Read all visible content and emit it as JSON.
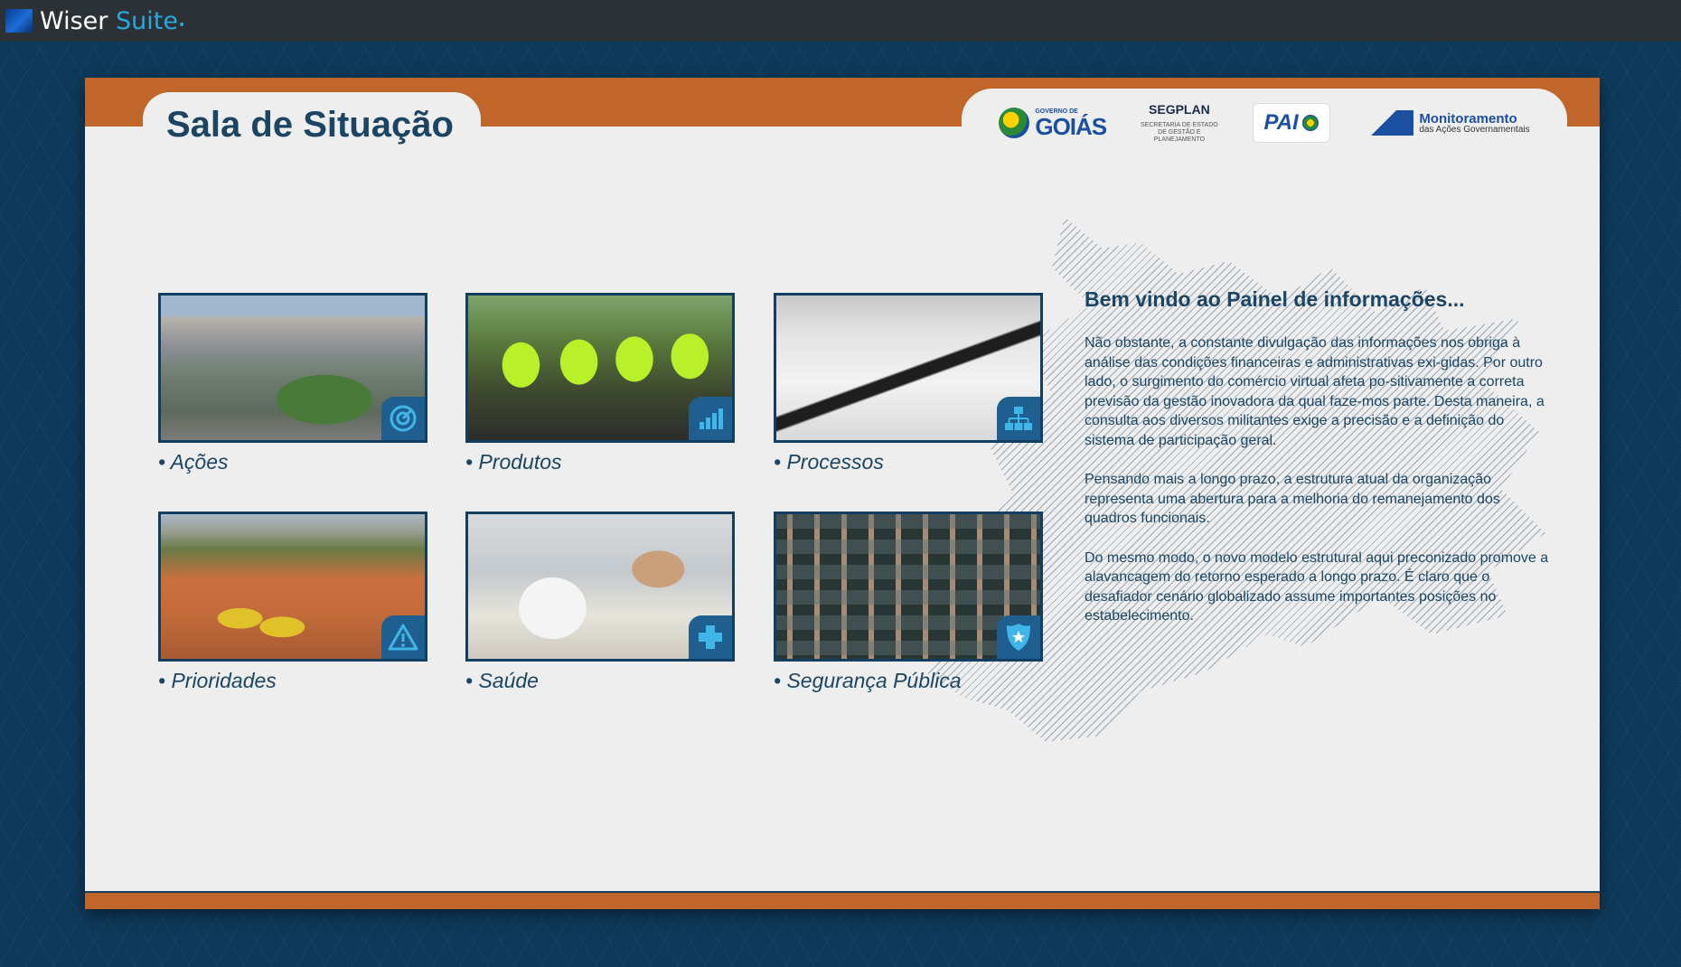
{
  "app": {
    "name_primary": "Wiser",
    "name_accent": "Suite",
    "name_dot": "•"
  },
  "page": {
    "title": "Sala de Situação"
  },
  "logos": {
    "goias_small": "GOVERNO DE",
    "goias_big": "GOIÁS",
    "segplan_title": "SEGPLAN",
    "segplan_subtitle": "SECRETARIA DE ESTADO DE GESTÃO E PLANEJAMENTO",
    "pai_text": "PAI",
    "monitoramento_title": "Monitoramento",
    "monitoramento_subtitle": "das Ações Governamentais"
  },
  "tiles": [
    {
      "label": "• Ações",
      "icon": "target-icon"
    },
    {
      "label": "• Produtos",
      "icon": "bar-chart-icon"
    },
    {
      "label": "• Processos",
      "icon": "org-chart-icon"
    },
    {
      "label": "• Prioridades",
      "icon": "warning-icon"
    },
    {
      "label": "• Saúde",
      "icon": "plus-icon"
    },
    {
      "label": "• Segurança Pública",
      "icon": "police-badge-icon"
    }
  ],
  "welcome": {
    "title": "Bem vindo ao Painel de informações...",
    "paragraphs": [
      "Não obstante, a constante divulgação das informações nos obriga à análise das condições financeiras e administrativas exi-gidas. Por outro lado, o surgimento do comércio virtual afeta po-sitivamente a correta previsão da gestão inovadora da qual faze-mos parte. Desta maneira, a consulta aos diversos militantes exige a precisão e a definição do sistema de participação geral.",
      "Pensando mais a longo prazo, a estrutura atual da organização representa uma abertura para a melhoria do remanejamento dos quadros funcionais.",
      "Do mesmo modo, o novo modelo estrutural aqui preconizado promove a alavancagem do retorno esperado a longo prazo. É claro que o desafiador cenário globalizado assume importantes posições no estabelecimento."
    ]
  },
  "colors": {
    "accent_orange": "#c0662a",
    "title_blue": "#1b4563",
    "background": "#0d3a5a",
    "badge_blue": "#1f5f8f"
  }
}
